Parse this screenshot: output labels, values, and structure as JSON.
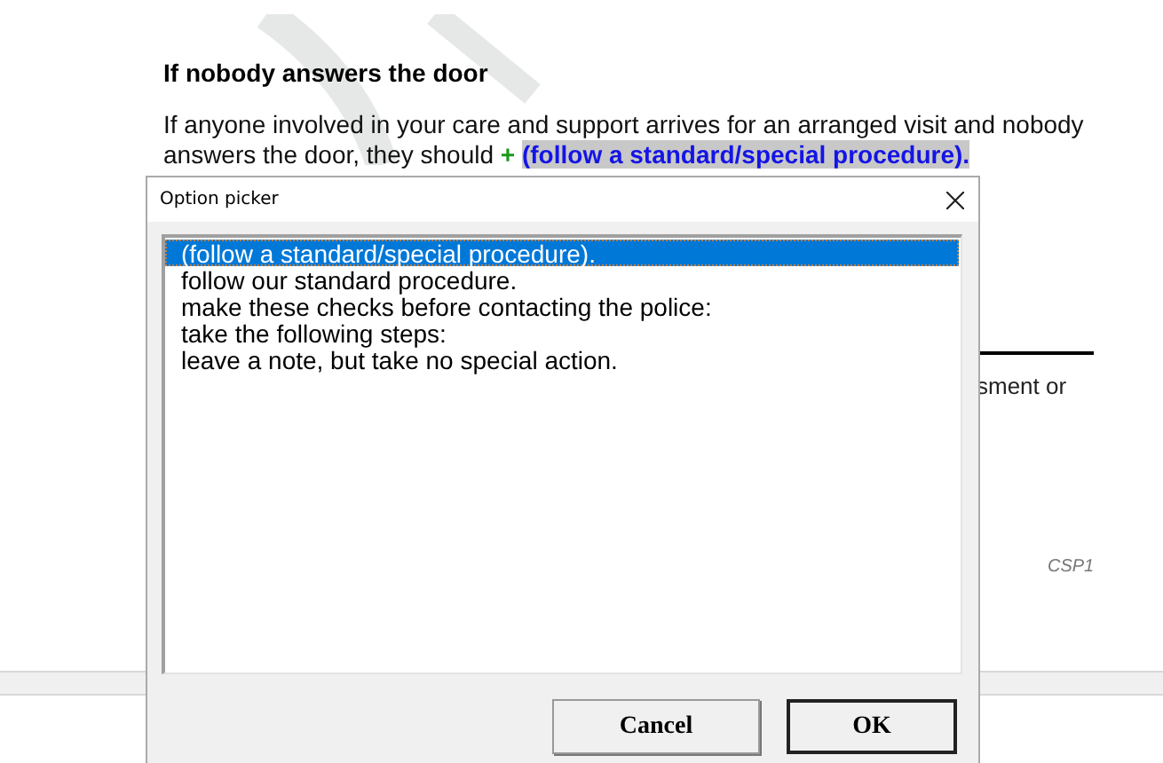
{
  "document": {
    "heading": "If nobody answers the door",
    "paragraph": "If anyone involved in your care and support arrives for an arranged visit and nobody answers the door, they should",
    "insert_marker": "+",
    "field_value": "(follow a standard/special procedure).",
    "fragment": "sment or",
    "footer_code": "CSP1"
  },
  "dialog": {
    "title": "Option picker",
    "options": [
      {
        "label": "(follow a standard/special procedure).",
        "selected": true
      },
      {
        "label": "follow our standard procedure.",
        "selected": false
      },
      {
        "label": "make these checks before contacting the police:",
        "selected": false
      },
      {
        "label": "take the following steps:",
        "selected": false
      },
      {
        "label": "leave a note, but take no special action.",
        "selected": false
      }
    ],
    "buttons": [
      {
        "label": "Cancel",
        "default": false
      },
      {
        "label": "OK",
        "default": true
      }
    ]
  }
}
